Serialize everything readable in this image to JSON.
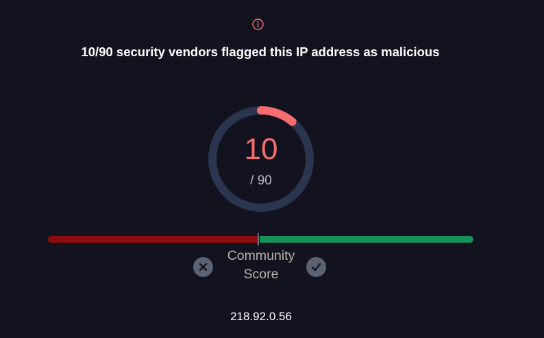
{
  "detection": {
    "headline": "10/90 security vendors flagged this IP address as malicious",
    "malicious_count": "10",
    "total_label": "/ 90",
    "malicious": 10,
    "total": 90
  },
  "community": {
    "label": "Community Score"
  },
  "ip": "218.92.0.56",
  "icons": {
    "info": "info-icon",
    "vote_down": "close-icon",
    "vote_up": "check-icon"
  },
  "colors": {
    "background": "#13131f",
    "malicious": "#f76d6d",
    "gauge_track": "#2b3550",
    "bar_bad": "#8e0c0c",
    "bar_good": "#17925a",
    "vote_button": "#5b6274"
  }
}
